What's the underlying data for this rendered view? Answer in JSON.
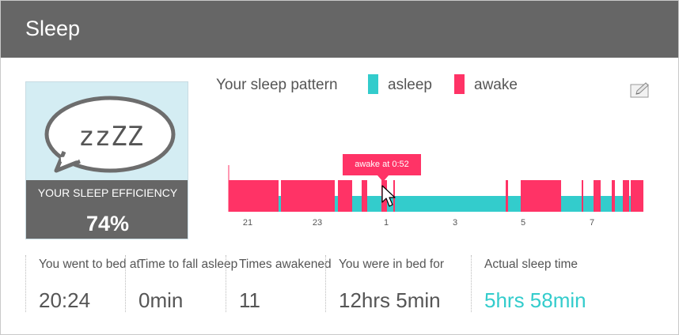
{
  "header": {
    "title": "Sleep"
  },
  "efficiency": {
    "icon_text": "zzZZ",
    "label": "YOUR SLEEP EFFICIENCY",
    "value": "74%"
  },
  "pattern": {
    "title": "Your sleep pattern",
    "legend": [
      {
        "label": "asleep",
        "color": "#33cccc"
      },
      {
        "label": "awake",
        "color": "#ff3366"
      }
    ],
    "tooltip": "awake at 0:52",
    "hour_ticks": [
      "21",
      "23",
      "1",
      "3",
      "5",
      "7"
    ]
  },
  "stats": [
    {
      "label": "You went to bed at",
      "value": "20:24"
    },
    {
      "label": "Time to fall asleep",
      "value": "0min"
    },
    {
      "label": "Times awakened",
      "value": "11"
    },
    {
      "label": "You were in bed for",
      "value": "12hrs 5min"
    },
    {
      "label": "Actual sleep time",
      "value": "5hrs 58min",
      "color": "#33cccc"
    }
  ],
  "colors": {
    "asleep": "#33cccc",
    "awake": "#ff3366",
    "header": "#666666"
  }
}
